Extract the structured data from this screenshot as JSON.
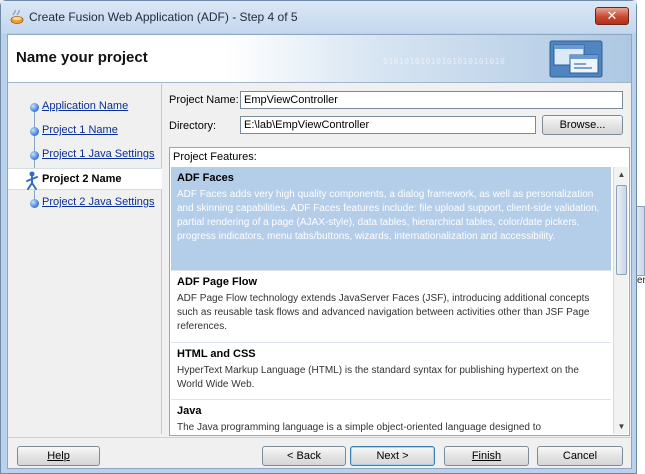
{
  "window": {
    "title": "Create Fusion Web Application (ADF) - Step 4 of 5",
    "close_label": "✕"
  },
  "header": {
    "title": "Name your project",
    "binary_text": "01010101010101010101010"
  },
  "nav": {
    "items": [
      {
        "label": "Application Name",
        "current": false
      },
      {
        "label": "Project 1 Name",
        "current": false
      },
      {
        "label": "Project 1 Java Settings",
        "current": false
      },
      {
        "label": "Project 2 Name",
        "current": true
      },
      {
        "label": "Project 2 Java Settings",
        "current": false
      }
    ]
  },
  "form": {
    "project_name_label": "Project Name:",
    "project_name_value": "EmpViewController",
    "directory_label": "Directory:",
    "directory_value": "E:\\lab\\EmpViewController",
    "browse_label": "Browse..."
  },
  "features": {
    "label": "Project Features:",
    "items": [
      {
        "name": "ADF Faces",
        "description": "ADF Faces adds very high quality components, a dialog framework, as well as personalization and skinning capabilities. ADF Faces features include: file upload support, client-side validation, partial rendering of a page (AJAX-style), data tables, hierarchical tables, color/date pickers, progress indicators, menu tabs/buttons, wizards, internationalization and accessibility.",
        "selected": true
      },
      {
        "name": "ADF Page Flow",
        "description": "ADF Page Flow technology extends JavaServer Faces (JSF), introducing additional concepts such as reusable task flows and advanced navigation between activities other than JSF Page references.",
        "selected": false
      },
      {
        "name": "HTML and CSS",
        "description": "HyperText Markup Language (HTML) is the standard syntax for publishing hypertext on the World Wide Web.",
        "selected": false
      },
      {
        "name": "Java",
        "description": "The Java programming language is a simple object-oriented language designed to",
        "selected": false
      }
    ]
  },
  "footer": {
    "help": "Help",
    "back": "< Back",
    "next": "Next >",
    "finish": "Finish",
    "cancel": "Cancel"
  },
  "background": {
    "text": "er"
  },
  "icons": {
    "app": "oracle-jdeveloper-cup-icon",
    "header": "wizard-windows-icon",
    "close": "close-icon"
  },
  "colors": {
    "selected_row": "#b4cde9",
    "link": "#0a2f9a",
    "title_bar": "#c3d7ee"
  }
}
